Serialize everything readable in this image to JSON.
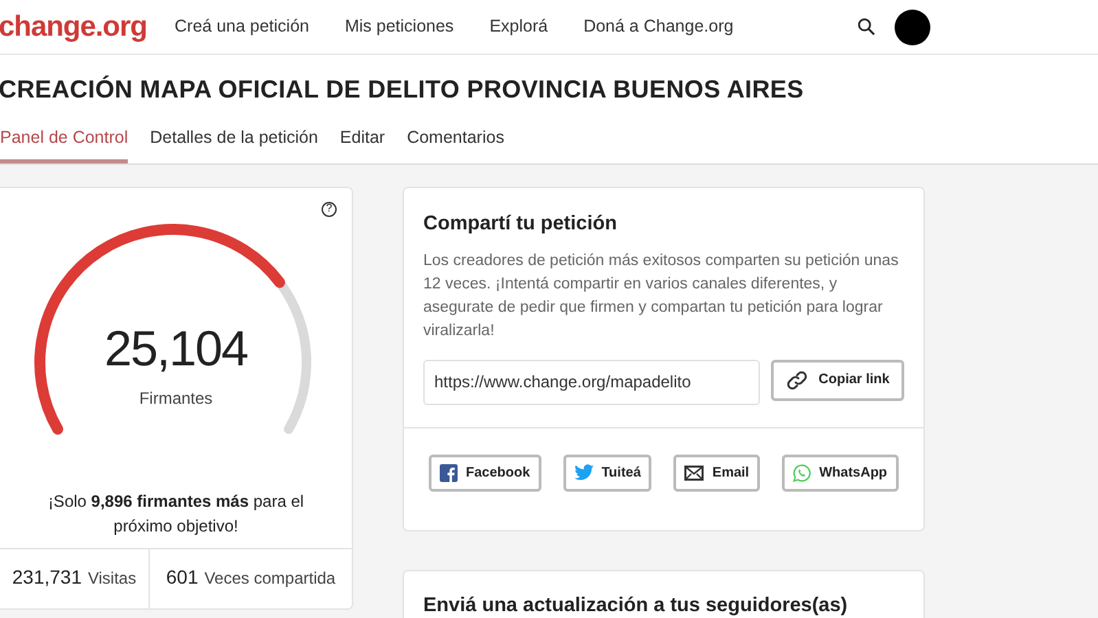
{
  "header": {
    "logo": "change.org",
    "nav": [
      "Creá una petición",
      "Mis peticiones",
      "Explorá",
      "Doná a Change.org"
    ]
  },
  "title": "CREACIÓN MAPA OFICIAL DE DELITO PROVINCIA BUENOS AIRES",
  "tabs": [
    {
      "label": "Panel de Control",
      "selected": true
    },
    {
      "label": "Detalles de la petición",
      "selected": false
    },
    {
      "label": "Editar",
      "selected": false
    },
    {
      "label": "Comentarios",
      "selected": false
    }
  ],
  "gauge": {
    "help": "?",
    "count": "25,104",
    "caption": "Firmantes",
    "goal_text": "¡Solo **9,896 firmantes más** para el próximo objetivo!",
    "stats": [
      {
        "count": "231,731",
        "unit": "Visitas"
      },
      {
        "count": "601",
        "unit": "Veces compartida"
      }
    ]
  },
  "share": {
    "heading": "Compartí tu petición",
    "text": "Los creadores de petición más exitosos comparten su petición unas 12 veces. ¡Intentá compartir en varios canales diferentes, y asegurate de pedir que firmen y compartan tu petición para lograr viralizarla!",
    "link": "https://www.change.org/mapadelito",
    "copy": "Copiar link",
    "buttons": [
      {
        "kind": "facebook",
        "label": "Facebook"
      },
      {
        "kind": "twitter",
        "label": "Tuiteá"
      },
      {
        "kind": "email",
        "label": "Email"
      },
      {
        "kind": "whatsapp",
        "label": "WhatsApp"
      }
    ]
  },
  "update": {
    "heading": "Enviá una actualización a tus seguidores(as)"
  }
}
